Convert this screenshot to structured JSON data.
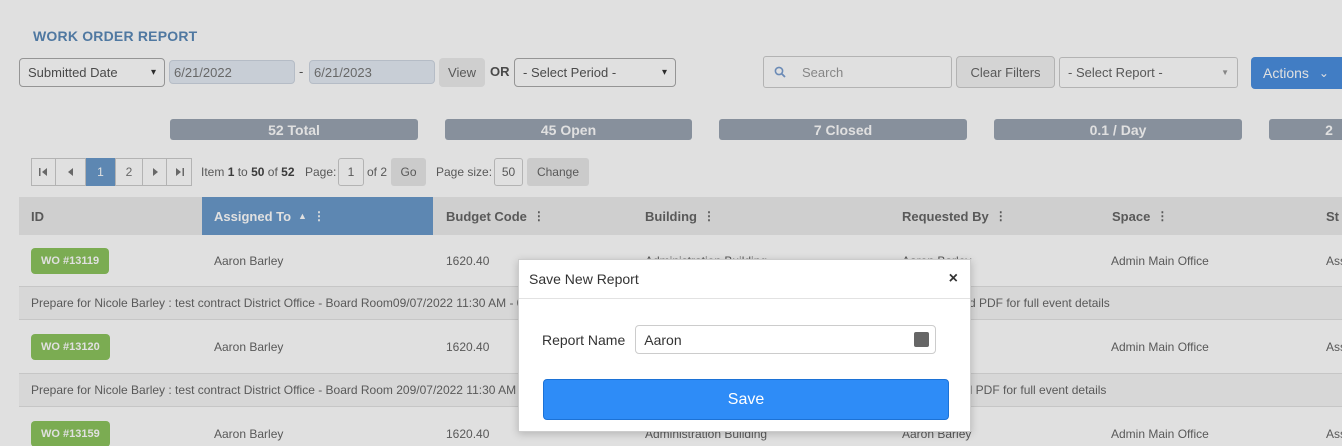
{
  "page_title": "WORK ORDER REPORT",
  "toolbar": {
    "date_field": "Submitted Date",
    "date_from": "6/21/2022",
    "date_separator": "-",
    "date_to": "6/21/2023",
    "view_label": "View",
    "or_label": "OR",
    "period_placeholder": "- Select Period -",
    "search_placeholder": "Search",
    "clear_filters_label": "Clear Filters",
    "report_placeholder": "- Select Report -",
    "actions_label": "Actions"
  },
  "stats": [
    "52 Total",
    "45 Open",
    "7 Closed",
    "0.1 / Day",
    "2"
  ],
  "pager": {
    "pages": [
      "1",
      "2"
    ],
    "current_page": "1",
    "item_prefix": "Item",
    "item_from": "1",
    "item_to_word": "to",
    "item_to": "50",
    "of_word": "of",
    "total_items": "52",
    "page_label": "Page:",
    "page_value": "1",
    "page_of": "of 2",
    "go_label": "Go",
    "page_size_label": "Page size:",
    "page_size_value": "50",
    "change_label": "Change"
  },
  "table": {
    "columns": [
      "ID",
      "Assigned To",
      "Budget Code",
      "Building",
      "Requested By",
      "Space",
      "St"
    ],
    "sorted_column": "Assigned To",
    "rows": [
      {
        "id": "WO #13119",
        "assigned": "Aaron Barley",
        "budget": "1620.40",
        "building": "Administration Building",
        "requested": "Aaron Barley",
        "space": "Admin Main Office",
        "status": "Ass",
        "note": "Prepare for Nicole Barley : test contract District Office - Board Room09/07/2022 11:30 AM - 0",
        "note_tail": "d PDF for full event details"
      },
      {
        "id": "WO #13120",
        "assigned": "Aaron Barley",
        "budget": "1620.40",
        "building": "",
        "requested": "",
        "space": "Admin Main Office",
        "status": "Ass",
        "note": "Prepare for Nicole Barley : test contract District Office - Board Room 209/07/2022 11:30 AM",
        "note_tail": "ed PDF for full event details"
      },
      {
        "id": "WO #13159",
        "assigned": "Aaron Barley",
        "budget": "1620.40",
        "building": "Administration Building",
        "requested": "Aaron Barley",
        "space": "Admin Main Office",
        "status": "Ass",
        "note": "",
        "note_tail": ""
      }
    ]
  },
  "modal": {
    "title": "Save New Report",
    "close_glyph": "×",
    "field_label": "Report Name",
    "field_value": "Aaron",
    "save_label": "Save"
  },
  "colors": {
    "accent": "#4a8fe0",
    "save_button": "#2e8cf7",
    "wo_badge": "#8dc45e",
    "stat_badge": "#9aa4b2",
    "title": "#5b89b8"
  }
}
